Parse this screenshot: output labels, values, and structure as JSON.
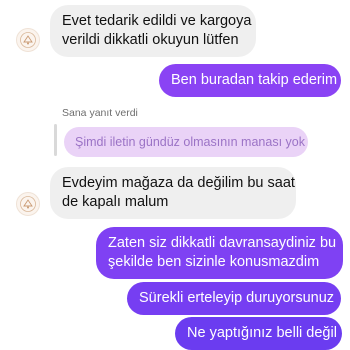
{
  "colors": {
    "incoming_bg": "#efefef",
    "outgoing_top": "#8a43f4",
    "outgoing_bottom": "#6b3cf0",
    "quoted_bg": "#ead3f7"
  },
  "messages": [
    {
      "direction": "incoming",
      "lines": [
        "Evet tedarik edildi ve kargoya",
        "verildi dikkatli okuyun lütfen"
      ]
    },
    {
      "direction": "outgoing",
      "lines": [
        "Ben buradan takip ederim"
      ]
    },
    {
      "direction": "reply",
      "reply_label": "Sana yanıt verdi",
      "quoted_text": "Şimdi iletin gündüz olmasının manası yok"
    },
    {
      "direction": "incoming",
      "lines": [
        "Evdeyim mağaza da değilim bu saat",
        "de kapalı malum"
      ]
    },
    {
      "direction": "outgoing",
      "lines": [
        "Zaten siz dikkatli davransaydiniz bu",
        "şekilde ben sizinle konusmazdim"
      ]
    },
    {
      "direction": "outgoing",
      "lines": [
        "Sürekli erteleyip duruyorsunuz"
      ]
    },
    {
      "direction": "outgoing",
      "lines": [
        "Ne yaptığınız belli değil"
      ]
    }
  ]
}
